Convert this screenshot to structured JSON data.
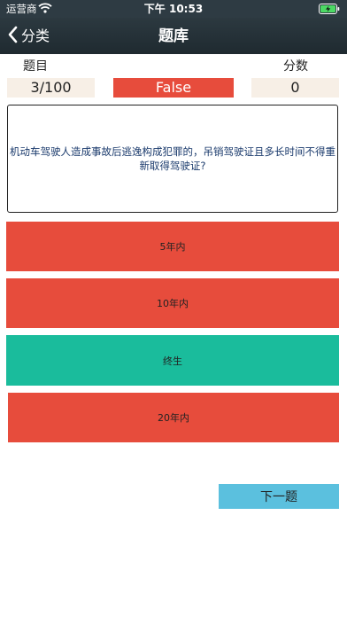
{
  "status_bar": {
    "carrier": "运营商",
    "time": "下午 10:53",
    "wifi_icon": "wifi-icon",
    "battery_icon": "battery-charging-icon"
  },
  "nav": {
    "back_label": "分类",
    "back_icon": "chevron-left-icon",
    "title": "题库"
  },
  "stats": {
    "question_label": "题目",
    "question_value": "3/100",
    "result": "False",
    "score_label": "分数",
    "score_value": "0"
  },
  "question": "机动车驾驶人造成事故后逃逸构成犯罪的，吊销驾驶证且多长时间不得重新取得驾驶证?",
  "options": [
    {
      "label": "5年内",
      "state": "wrong",
      "color": "#e74c3c"
    },
    {
      "label": "10年内",
      "state": "wrong",
      "color": "#e74c3c"
    },
    {
      "label": "终生",
      "state": "correct",
      "color": "#1abc9c"
    },
    {
      "label": "20年内",
      "state": "wrong",
      "color": "#e74c3c"
    }
  ],
  "next_button": "下一题",
  "colors": {
    "nav_bg": "#2e3b43",
    "wrong": "#e74c3c",
    "correct": "#1abc9c",
    "value_box": "#f7efe6",
    "next": "#5bc0de"
  }
}
